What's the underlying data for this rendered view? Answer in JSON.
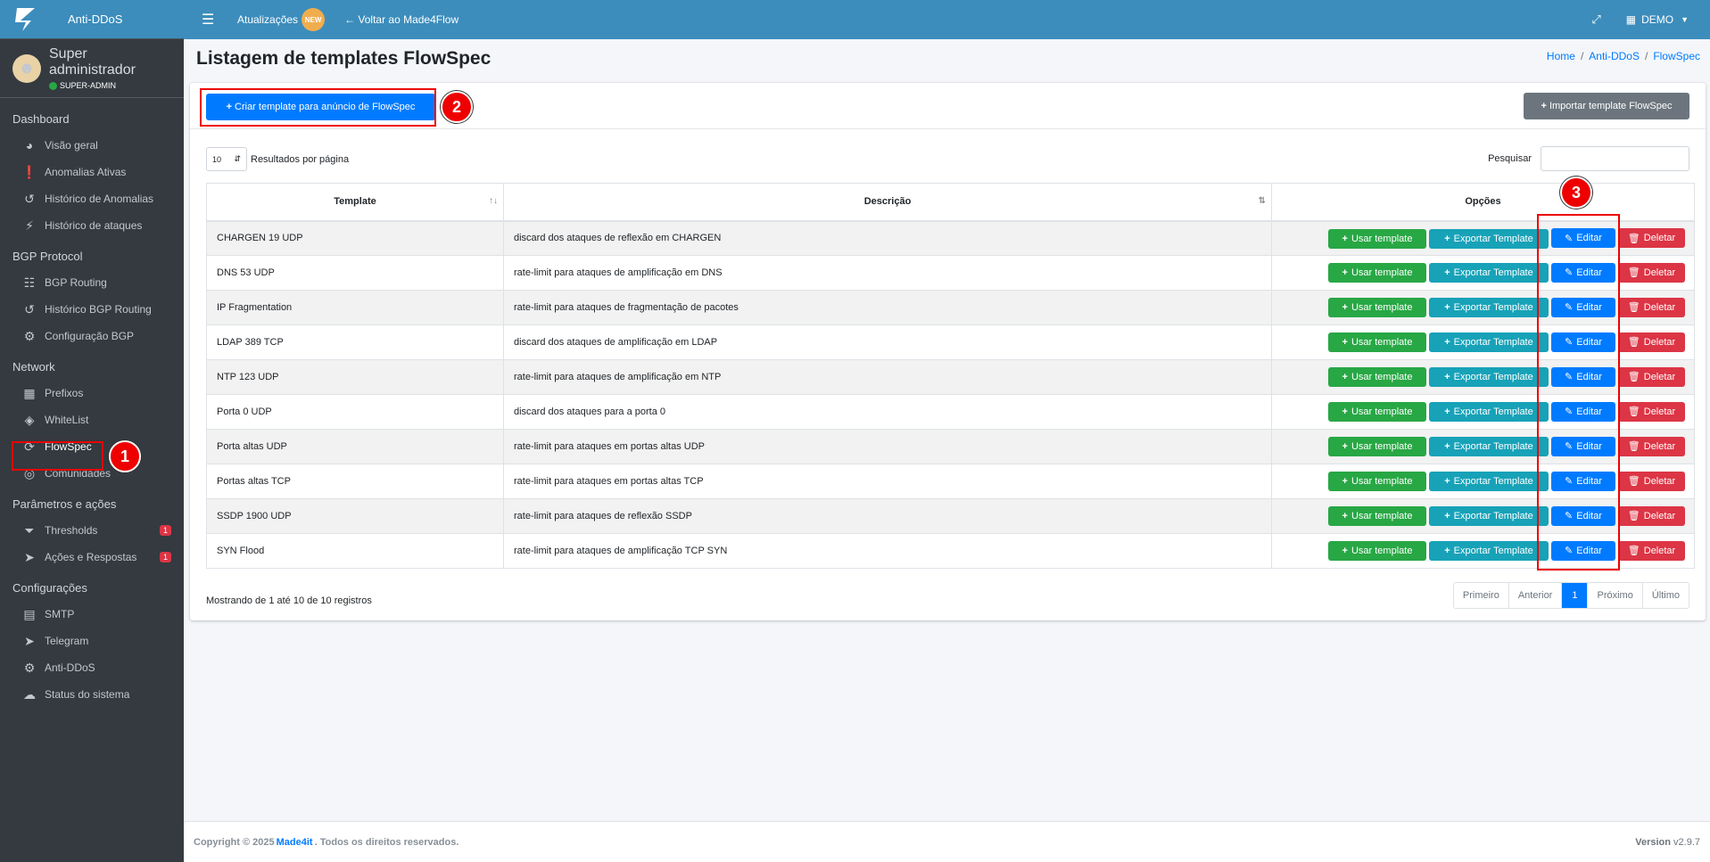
{
  "brand": {
    "name": "Anti-DDoS"
  },
  "user": {
    "name": "Super administrador",
    "role": "SUPER-ADMIN"
  },
  "sidebar": {
    "sections": [
      {
        "header": "Dashboard",
        "items": [
          {
            "label": "Visão geral",
            "icon": "gauge-icon"
          },
          {
            "label": "Anomalias Ativas",
            "icon": "alert-icon"
          },
          {
            "label": "Histórico de Anomalias",
            "icon": "history-icon"
          },
          {
            "label": "Histórico de ataques",
            "icon": "bolt-icon"
          }
        ]
      },
      {
        "header": "BGP Protocol",
        "items": [
          {
            "label": "BGP Routing",
            "icon": "network-icon"
          },
          {
            "label": "Histórico BGP Routing",
            "icon": "history-icon"
          },
          {
            "label": "Configuração BGP",
            "icon": "gear-icon"
          }
        ]
      },
      {
        "header": "Network",
        "items": [
          {
            "label": "Prefixos",
            "icon": "sitemap-icon"
          },
          {
            "label": "WhiteList",
            "icon": "shield-icon"
          },
          {
            "label": "FlowSpec",
            "icon": "route-icon"
          },
          {
            "label": "Comunidades",
            "icon": "globe-icon"
          }
        ]
      },
      {
        "header": "Parâmetros e ações",
        "items": [
          {
            "label": "Thresholds",
            "icon": "filter-icon",
            "badge": "1"
          },
          {
            "label": "Ações e Respostas",
            "icon": "rocket-icon",
            "badge": "1"
          }
        ]
      },
      {
        "header": "Configurações",
        "items": [
          {
            "label": "SMTP",
            "icon": "mail-server-icon"
          },
          {
            "label": "Telegram",
            "icon": "telegram-icon"
          },
          {
            "label": "Anti-DDoS",
            "icon": "gears-icon"
          },
          {
            "label": "Status do sistema",
            "icon": "cloud-icon"
          }
        ]
      }
    ]
  },
  "navbar": {
    "updates": "Atualizações",
    "new_badge": "NEW",
    "back": "Voltar ao Made4Flow",
    "account": "DEMO"
  },
  "page": {
    "title": "Listagem de templates FlowSpec",
    "breadcrumb": [
      "Home",
      "Anti-DDoS",
      "FlowSpec"
    ]
  },
  "actions": {
    "create": "Criar template para anúncio de FlowSpec",
    "import": "Importar template FlowSpec"
  },
  "controls": {
    "page_size": "10",
    "per_page_label": "Resultados por página",
    "search_label": "Pesquisar"
  },
  "table": {
    "headers": [
      "Template",
      "Descrição",
      "Opções"
    ],
    "buttons": {
      "use": "Usar template",
      "export": "Exportar Template",
      "edit": "Editar",
      "delete": "Deletar"
    },
    "rows": [
      {
        "template": "CHARGEN 19 UDP",
        "description": "discard dos ataques de reflexão em CHARGEN"
      },
      {
        "template": "DNS 53 UDP",
        "description": "rate-limit para ataques de amplificação em DNS"
      },
      {
        "template": "IP Fragmentation",
        "description": "rate-limit para ataques de fragmentação de pacotes"
      },
      {
        "template": "LDAP 389 TCP",
        "description": "discard dos ataques de amplificação em LDAP"
      },
      {
        "template": "NTP 123 UDP",
        "description": "rate-limit para ataques de amplificação em NTP"
      },
      {
        "template": "Porta 0 UDP",
        "description": "discard dos ataques para a porta 0"
      },
      {
        "template": "Porta altas UDP",
        "description": "rate-limit para ataques em portas altas UDP"
      },
      {
        "template": "Portas altas TCP",
        "description": "rate-limit para ataques em portas altas TCP"
      },
      {
        "template": "SSDP 1900 UDP",
        "description": "rate-limit para ataques de reflexão SSDP"
      },
      {
        "template": "SYN Flood",
        "description": "rate-limit para ataques de amplificação TCP SYN"
      }
    ]
  },
  "info": "Mostrando de 1 até 10 de 10 registros",
  "pagination": [
    "Primeiro",
    "Anterior",
    "1",
    "Próximo",
    "Último"
  ],
  "footer": {
    "copyright": "Copyright © 2025",
    "company": "Made4it",
    "rights": ". Todos os direitos reservados.",
    "version_label": "Version",
    "version": "v2.9.7"
  },
  "annotations": [
    "1",
    "2",
    "3"
  ]
}
